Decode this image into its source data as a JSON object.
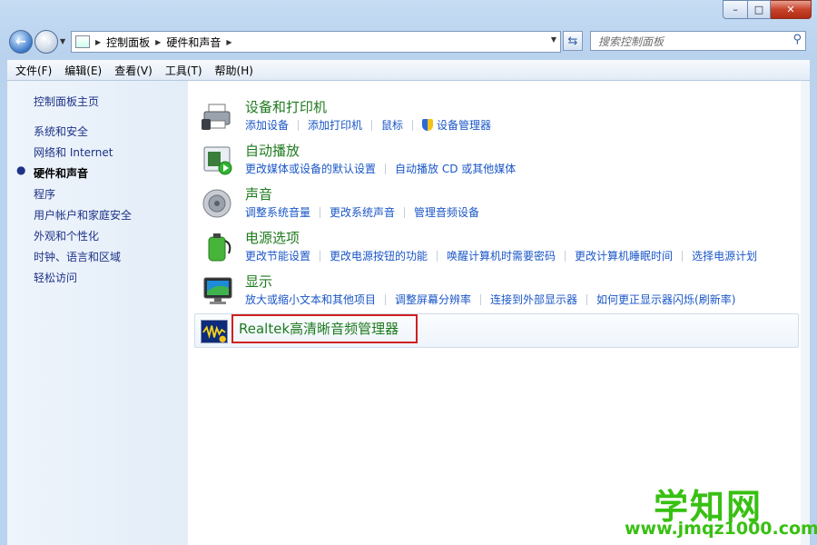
{
  "window": {
    "min_label": "–",
    "max_label": "□",
    "close_label": "✕"
  },
  "nav": {
    "breadcrumb": [
      "控制面板",
      "硬件和声音"
    ],
    "search_placeholder": "搜索控制面板"
  },
  "menu": [
    "文件(F)",
    "编辑(E)",
    "查看(V)",
    "工具(T)",
    "帮助(H)"
  ],
  "sidebar": {
    "home": "控制面板主页",
    "items": [
      {
        "label": "系统和安全",
        "active": false
      },
      {
        "label": "网络和 Internet",
        "active": false
      },
      {
        "label": "硬件和声音",
        "active": true
      },
      {
        "label": "程序",
        "active": false
      },
      {
        "label": "用户帐户和家庭安全",
        "active": false
      },
      {
        "label": "外观和个性化",
        "active": false
      },
      {
        "label": "时钟、语言和区域",
        "active": false
      },
      {
        "label": "轻松访问",
        "active": false
      }
    ]
  },
  "sections": [
    {
      "title": "设备和打印机",
      "links": [
        "添加设备",
        "添加打印机",
        "鼠标",
        "设备管理器"
      ]
    },
    {
      "title": "自动播放",
      "links": [
        "更改媒体或设备的默认设置",
        "自动播放 CD 或其他媒体"
      ]
    },
    {
      "title": "声音",
      "links": [
        "调整系统音量",
        "更改系统声音",
        "管理音频设备"
      ]
    },
    {
      "title": "电源选项",
      "links": [
        "更改节能设置",
        "更改电源按钮的功能",
        "唤醒计算机时需要密码",
        "更改计算机睡眠时间",
        "选择电源计划"
      ]
    },
    {
      "title": "显示",
      "links": [
        "放大或缩小文本和其他项目",
        "调整屏幕分辨率",
        "连接到外部显示器",
        "如何更正显示器闪烁(刷新率)"
      ]
    }
  ],
  "realtek": {
    "label": "Realtek高清晰音频管理器"
  },
  "watermark": {
    "title": "学知网",
    "url": "www.jmqz1000.com"
  },
  "colors": {
    "link": "#1a56c7",
    "heading": "#1f7a1f",
    "highlight": "#d0201f"
  }
}
